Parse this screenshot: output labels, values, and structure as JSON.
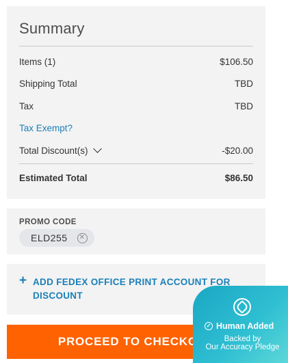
{
  "summary": {
    "title": "Summary",
    "items_label": "Items (1)",
    "items_value": "$106.50",
    "shipping_label": "Shipping Total",
    "shipping_value": "TBD",
    "tax_label": "Tax",
    "tax_value": "TBD",
    "tax_exempt_link": "Tax Exempt?",
    "discount_label": "Total Discount(s)",
    "discount_value": "-$20.00",
    "estimated_label": "Estimated Total",
    "estimated_value": "$86.50"
  },
  "promo": {
    "label": "PROMO CODE",
    "code": "ELD255",
    "remove_glyph": "✕"
  },
  "account": {
    "plus": "+",
    "text": "ADD FEDEX OFFICE PRINT ACCOUNT FOR DISCOUNT"
  },
  "checkout": {
    "label": "PROCEED TO CHECKOUT"
  },
  "badge": {
    "check_glyph": "✓",
    "added": "Human Added",
    "backed_by": "Backed by",
    "pledge": "Our Accuracy Pledge"
  },
  "colors": {
    "link": "#1a7fb8",
    "checkout": "#ff6200",
    "card_bg": "#f3f3f3"
  }
}
